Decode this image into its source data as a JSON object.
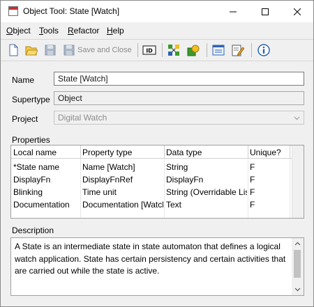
{
  "window": {
    "title": "Object Tool: State [Watch]",
    "icon": "app-window-icon"
  },
  "menu": {
    "items": [
      {
        "label_underlined": "O",
        "label_rest": "bject"
      },
      {
        "label_underlined": "T",
        "label_rest": "ools"
      },
      {
        "label_underlined": "R",
        "label_rest": "efactor"
      },
      {
        "label_underlined": "H",
        "label_rest": "elp"
      }
    ]
  },
  "toolbar": {
    "save_and_close_label": "Save and Close",
    "icons": [
      "new-document-icon",
      "open-folder-icon",
      "save-icon",
      "save-and-close-icon",
      "id-icon",
      "graph-icon",
      "symbol-editor-icon",
      "form-icon",
      "edit-icon",
      "info-icon"
    ]
  },
  "form": {
    "name_label": "Name",
    "name_value": "State [Watch]",
    "supertype_label": "Supertype",
    "supertype_value": "Object",
    "project_label": "Project",
    "project_value": "Digital Watch",
    "properties_label": "Properties",
    "description_label": "Description"
  },
  "properties": {
    "columns": [
      "Local name",
      "Property type",
      "Data type",
      "Unique?"
    ],
    "rows": [
      [
        "*State name",
        "Name [Watch]",
        "String",
        "F"
      ],
      [
        "DisplayFn",
        "DisplayFnRef",
        "DisplayFn",
        "F"
      ],
      [
        "Blinking",
        "Time unit",
        "String (Overridable List)",
        "F"
      ],
      [
        "Documentation",
        "Documentation [Watch]",
        "Text",
        "F"
      ]
    ]
  },
  "description": {
    "text": "A State is an intermediate state in state automaton that defines a logical watch application. State has certain persistency and certain activities that are carried out while the state is active."
  },
  "colors": {
    "window_bg": "#f0f0f0",
    "field_border": "#7a7a7a",
    "disabled_text": "#8c8c8c",
    "icon_blue": "#2b63b0",
    "icon_green": "#3a9a2a",
    "icon_yellow": "#f0c020"
  }
}
